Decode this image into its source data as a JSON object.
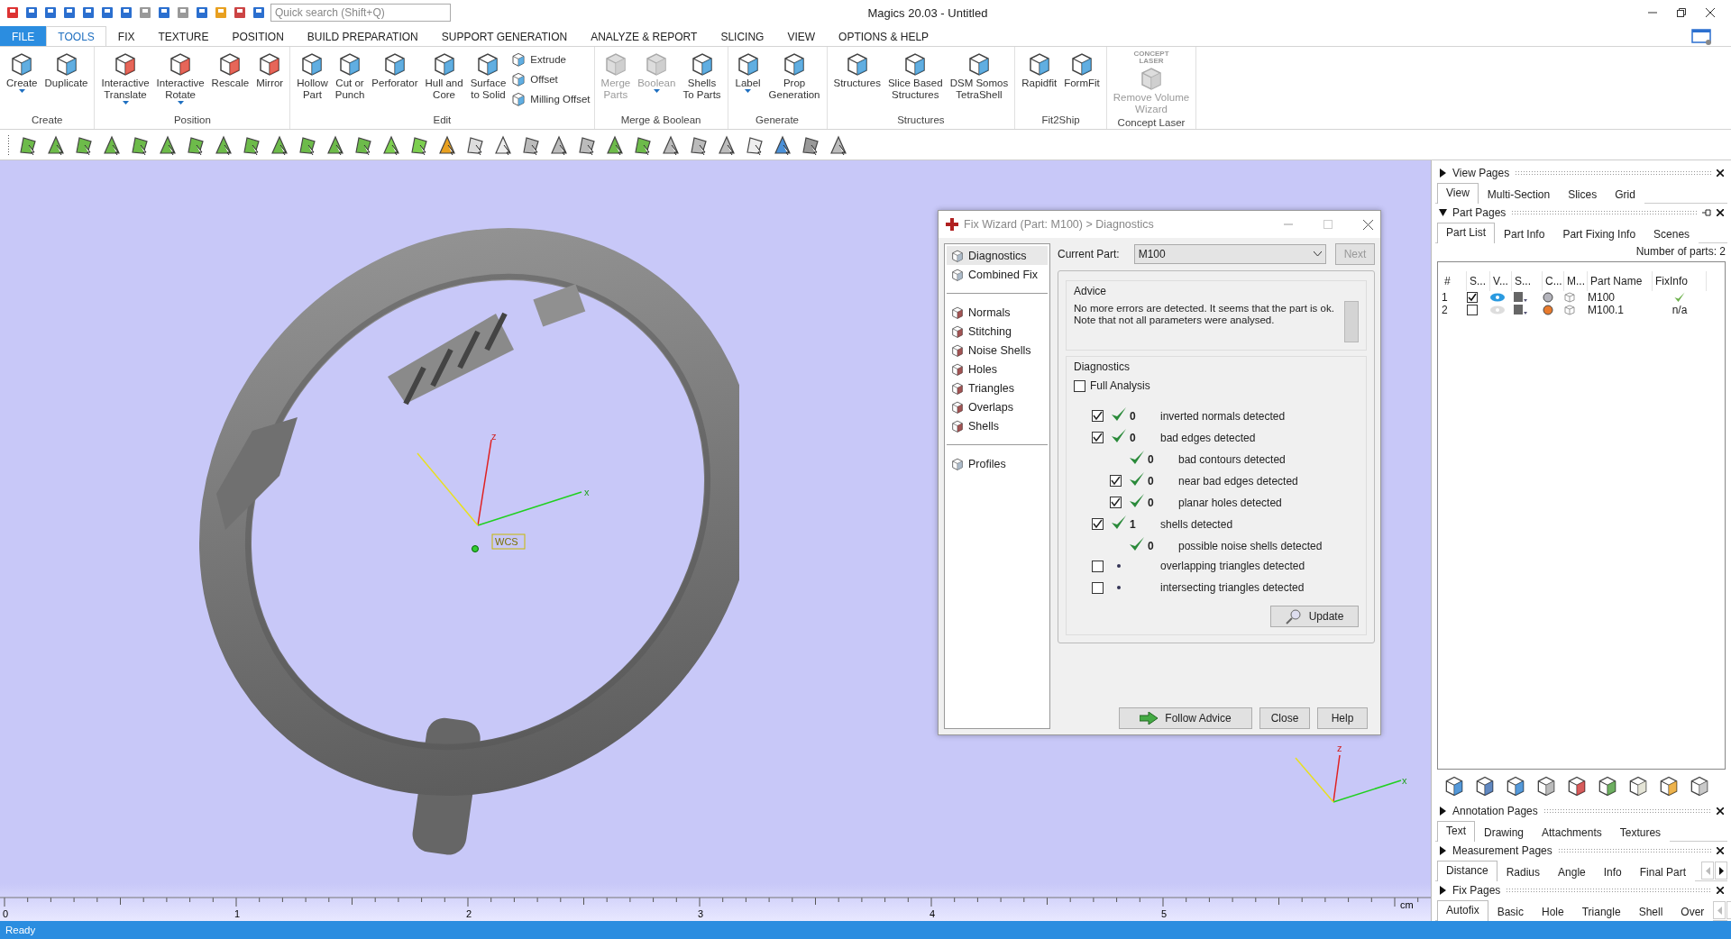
{
  "window": {
    "title": "Magics 20.03 - Untitled",
    "quick_search": {
      "placeholder": "Quick search (Shift+Q)"
    }
  },
  "ribbon_tabs": [
    {
      "label": "FILE",
      "kind": "file",
      "selected": false
    },
    {
      "label": "TOOLS",
      "kind": "tab",
      "selected": true
    },
    {
      "label": "FIX",
      "kind": "tab",
      "selected": false
    },
    {
      "label": "TEXTURE",
      "kind": "tab",
      "selected": false
    },
    {
      "label": "POSITION",
      "kind": "tab",
      "selected": false
    },
    {
      "label": "BUILD PREPARATION",
      "kind": "tab",
      "selected": false
    },
    {
      "label": "SUPPORT GENERATION",
      "kind": "tab",
      "selected": false
    },
    {
      "label": "ANALYZE & REPORT",
      "kind": "tab",
      "selected": false
    },
    {
      "label": "SLICING",
      "kind": "tab",
      "selected": false
    },
    {
      "label": "VIEW",
      "kind": "tab",
      "selected": false
    },
    {
      "label": "OPTIONS & HELP",
      "kind": "tab",
      "selected": false
    }
  ],
  "ribbon_groups": [
    {
      "label": "Create",
      "items": [
        {
          "label": "Create",
          "kind": "large",
          "dropdown": true,
          "disabled": false
        },
        {
          "label": "Duplicate",
          "kind": "large",
          "dropdown": false,
          "disabled": false
        }
      ]
    },
    {
      "label": "Position",
      "items": [
        {
          "label": "Interactive\nTranslate",
          "kind": "large",
          "dropdown": true,
          "disabled": false
        },
        {
          "label": "Interactive\nRotate",
          "kind": "large",
          "dropdown": true,
          "disabled": false
        },
        {
          "label": "Rescale",
          "kind": "large",
          "dropdown": false,
          "disabled": false
        },
        {
          "label": "Mirror",
          "kind": "large",
          "dropdown": false,
          "disabled": false
        }
      ]
    },
    {
      "label": "Edit",
      "items": [
        {
          "label": "Hollow\nPart",
          "kind": "large",
          "dropdown": false,
          "disabled": false
        },
        {
          "label": "Cut or\nPunch",
          "kind": "large",
          "dropdown": false,
          "disabled": false
        },
        {
          "label": "Perforator",
          "kind": "large",
          "dropdown": false,
          "disabled": false
        },
        {
          "label": "Hull and\nCore",
          "kind": "large",
          "dropdown": false,
          "disabled": false
        },
        {
          "label": "Surface\nto Solid",
          "kind": "large",
          "dropdown": false,
          "disabled": false
        },
        {
          "label": "Extrude",
          "kind": "small",
          "disabled": false
        },
        {
          "label": "Offset",
          "kind": "small",
          "disabled": false
        },
        {
          "label": "Milling Offset",
          "kind": "small",
          "disabled": false
        }
      ]
    },
    {
      "label": "Merge & Boolean",
      "items": [
        {
          "label": "Merge\nParts",
          "kind": "large",
          "dropdown": false,
          "disabled": true
        },
        {
          "label": "Boolean",
          "kind": "large",
          "dropdown": true,
          "disabled": true
        },
        {
          "label": "Shells\nTo Parts",
          "kind": "large",
          "dropdown": false,
          "disabled": false
        }
      ]
    },
    {
      "label": "Generate",
      "items": [
        {
          "label": "Label",
          "kind": "large",
          "dropdown": true,
          "disabled": false
        },
        {
          "label": "Prop\nGeneration",
          "kind": "large",
          "dropdown": false,
          "disabled": false
        }
      ]
    },
    {
      "label": "Structures",
      "items": [
        {
          "label": "Structures",
          "kind": "large",
          "dropdown": false,
          "disabled": false
        },
        {
          "label": "Slice Based\nStructures",
          "kind": "large",
          "dropdown": false,
          "disabled": false
        },
        {
          "label": "DSM Somos\nTetraShell",
          "kind": "large",
          "dropdown": false,
          "disabled": false
        }
      ]
    },
    {
      "label": "Fit2Ship",
      "items": [
        {
          "label": "Rapidfit",
          "kind": "large",
          "dropdown": false,
          "disabled": false
        },
        {
          "label": "FormFit",
          "kind": "large",
          "dropdown": false,
          "disabled": false
        }
      ]
    },
    {
      "label": "Concept Laser",
      "items": [
        {
          "label": "Remove Volume\nWizard",
          "kind": "large",
          "dropdown": false,
          "disabled": true,
          "icon_text": "CONCEPT\nLASER"
        }
      ]
    }
  ],
  "viewport": {
    "main_axes": {
      "z": "z",
      "x": "x",
      "origin": "WCS"
    },
    "corner_axes": {
      "z": "z",
      "x": "x"
    },
    "ruler": {
      "labels": [
        "0",
        "1",
        "2",
        "3",
        "4",
        "5"
      ],
      "unit": "cm"
    }
  },
  "fix_wizard": {
    "title": "Fix Wizard (Part: M100) > Diagnostics",
    "nav_groups": [
      [
        {
          "label": "Diagnostics",
          "selected": true
        },
        {
          "label": "Combined Fix",
          "selected": false
        }
      ],
      [
        {
          "label": "Normals",
          "selected": false
        },
        {
          "label": "Stitching",
          "selected": false
        },
        {
          "label": "Noise Shells",
          "selected": false
        },
        {
          "label": "Holes",
          "selected": false
        },
        {
          "label": "Triangles",
          "selected": false
        },
        {
          "label": "Overlaps",
          "selected": false
        },
        {
          "label": "Shells",
          "selected": false
        }
      ],
      [
        {
          "label": "Profiles",
          "selected": false
        }
      ]
    ],
    "current_part": {
      "label": "Current Part:",
      "value": "M100"
    },
    "next_button": {
      "label": "Next",
      "disabled": true
    },
    "advice": {
      "label": "Advice",
      "text": "No more errors are detected. It seems that the part is ok.\nNote that not all parameters were analysed."
    },
    "diagnostics": {
      "label": "Diagnostics",
      "full_analysis": {
        "label": "Full Analysis",
        "checked": false
      },
      "rows": [
        {
          "kind": "checkbox",
          "checked": true,
          "ok": true,
          "count": "0",
          "label": "inverted normals detected"
        },
        {
          "kind": "checkbox",
          "checked": true,
          "ok": true,
          "count": "0",
          "label": "bad edges detected",
          "children": [
            {
              "kind": "plain",
              "ok": true,
              "count": "0",
              "label": "bad contours detected"
            },
            {
              "kind": "checkbox",
              "checked": true,
              "ok": true,
              "count": "0",
              "label": "near bad edges detected"
            },
            {
              "kind": "checkbox",
              "checked": true,
              "ok": true,
              "count": "0",
              "label": "planar holes detected"
            }
          ]
        },
        {
          "kind": "checkbox",
          "checked": true,
          "ok": true,
          "count": "1",
          "label": "shells detected",
          "children": [
            {
              "kind": "plain",
              "ok": true,
              "count": "0",
              "label": "possible noise shells detected"
            }
          ]
        },
        {
          "kind": "checkbox",
          "checked": false,
          "ok": false,
          "label": "overlapping triangles detected"
        },
        {
          "kind": "checkbox",
          "checked": false,
          "ok": false,
          "label": "intersecting triangles detected"
        }
      ],
      "update_button": "Update"
    },
    "buttons": [
      {
        "label": "Follow Advice",
        "kind": "advice"
      },
      {
        "label": "Close",
        "kind": "plain"
      },
      {
        "label": "Help",
        "kind": "plain"
      }
    ]
  },
  "side_panel": [
    {
      "title": "View Pages",
      "expanded": false,
      "scrollable": false,
      "tabs": [
        {
          "label": "View",
          "selected": true
        },
        {
          "label": "Multi-Section",
          "selected": false
        },
        {
          "label": "Slices",
          "selected": false
        },
        {
          "label": "Grid",
          "selected": false
        }
      ]
    },
    {
      "title": "Part Pages",
      "expanded": true,
      "scrollable": false,
      "tabs": [
        {
          "label": "Part List",
          "selected": true
        },
        {
          "label": "Part Info",
          "selected": false
        },
        {
          "label": "Part Fixing Info",
          "selected": false
        },
        {
          "label": "Scenes",
          "selected": false
        }
      ],
      "part_count": "Number of parts: 2",
      "table": {
        "columns": [
          "#",
          "S...",
          "V...",
          "S...",
          "C...",
          "M...",
          "Part Name",
          "FixInfo"
        ],
        "rows": [
          {
            "number": "1",
            "checked": true,
            "visible": true,
            "color": "#b4b4bc",
            "name": "M100",
            "fix_ok": true
          },
          {
            "number": "2",
            "checked": false,
            "visible": false,
            "color": "#e87a2c",
            "name": "M100.1",
            "fix_ok": false,
            "fixinfo": "n/a"
          }
        ]
      }
    },
    {
      "title": "Annotation Pages",
      "expanded": false,
      "scrollable": false,
      "tabs": [
        {
          "label": "Text",
          "selected": true
        },
        {
          "label": "Drawing",
          "selected": false
        },
        {
          "label": "Attachments",
          "selected": false
        },
        {
          "label": "Textures",
          "selected": false
        }
      ]
    },
    {
      "title": "Measurement Pages",
      "expanded": false,
      "scrollable": true,
      "tabs": [
        {
          "label": "Distance",
          "selected": true
        },
        {
          "label": "Radius",
          "selected": false
        },
        {
          "label": "Angle",
          "selected": false
        },
        {
          "label": "Info",
          "selected": false
        },
        {
          "label": "Final Part",
          "selected": false
        }
      ]
    },
    {
      "title": "Fix Pages",
      "expanded": false,
      "scrollable": true,
      "tabs": [
        {
          "label": "Autofix",
          "selected": true
        },
        {
          "label": "Basic",
          "selected": false
        },
        {
          "label": "Hole",
          "selected": false
        },
        {
          "label": "Triangle",
          "selected": false
        },
        {
          "label": "Shell",
          "selected": false
        },
        {
          "label": "Over",
          "selected": false
        }
      ]
    }
  ],
  "status_bar": {
    "text": "Ready"
  }
}
